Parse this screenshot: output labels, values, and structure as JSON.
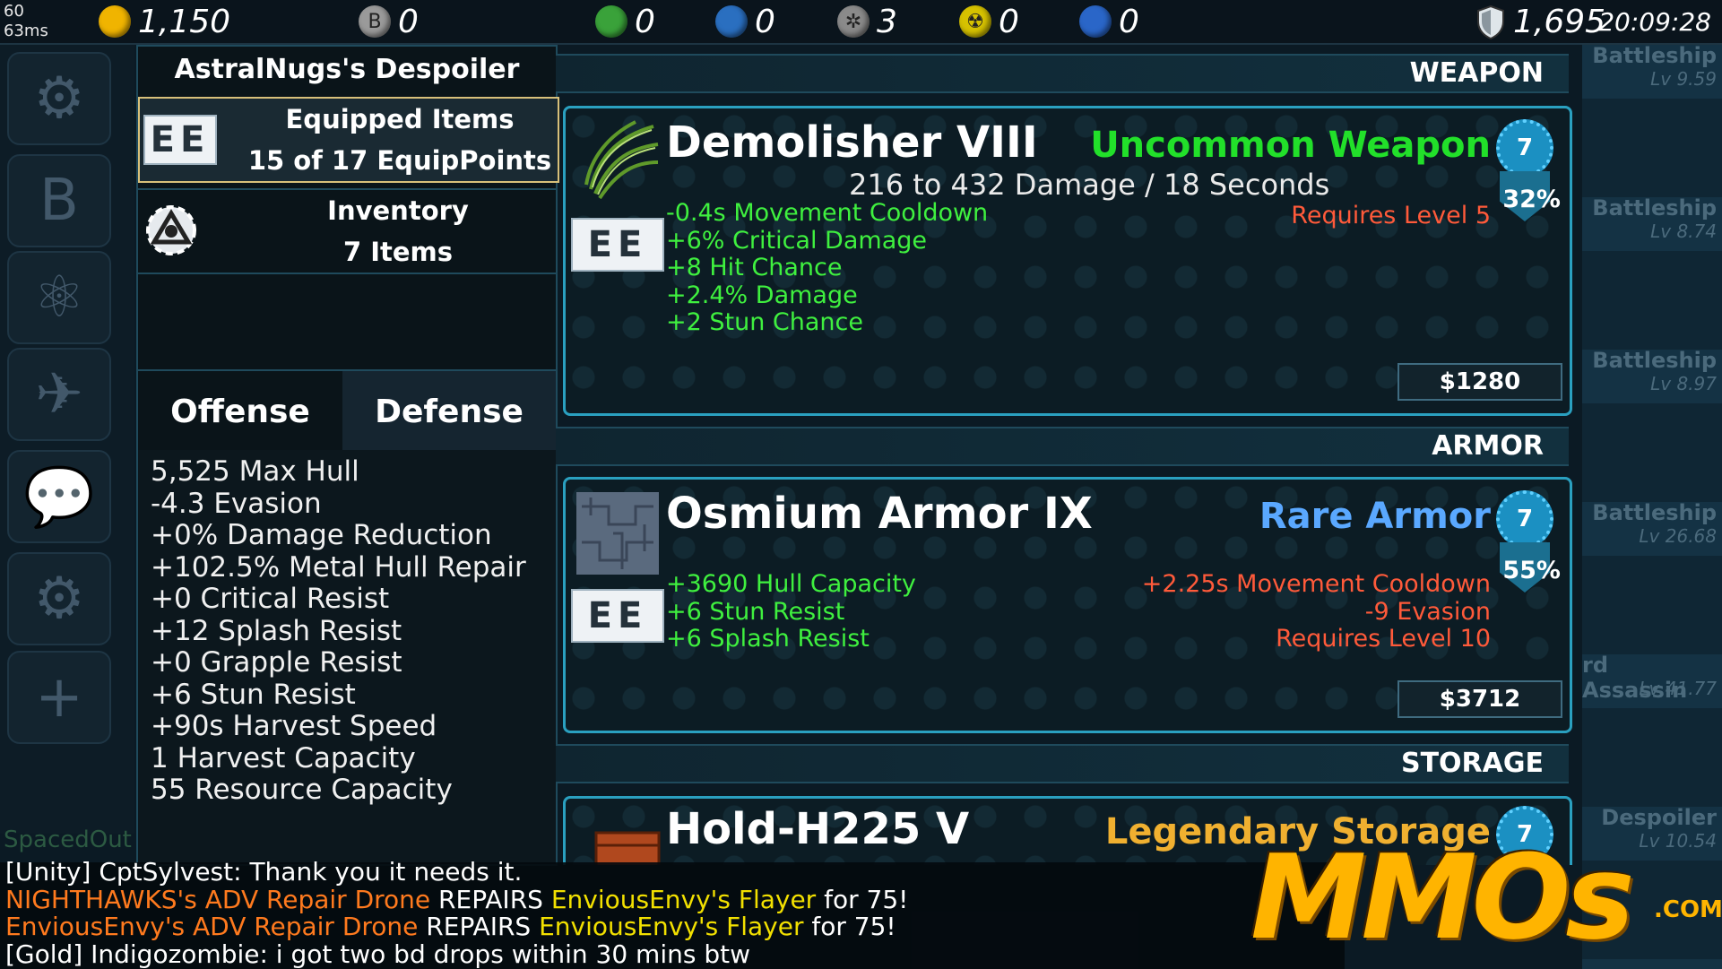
{
  "hud": {
    "fps": "60",
    "ping": "63ms",
    "resources": [
      {
        "icon": "gold-coin-icon",
        "color": "#f0b400",
        "glyph": "",
        "value": "1,150"
      },
      {
        "icon": "bitcoin-icon",
        "color": "#9a9a9a",
        "glyph": "B",
        "value": "0"
      },
      {
        "icon": "leaf-icon",
        "color": "#3aa23a",
        "glyph": "",
        "value": "0"
      },
      {
        "icon": "water-drop-icon",
        "color": "#2a6fc0",
        "glyph": "",
        "value": "0"
      },
      {
        "icon": "snowflake-icon",
        "color": "#8a8a8a",
        "glyph": "✲",
        "value": "3"
      },
      {
        "icon": "radiation-icon",
        "color": "#d6c200",
        "glyph": "☢",
        "value": "0"
      },
      {
        "icon": "gem-icon",
        "color": "#2a66c8",
        "glyph": "",
        "value": "0"
      }
    ],
    "shield_value": "1,695",
    "clock": "20:09:28"
  },
  "nav": [
    {
      "name": "nav-ship-gear-icon",
      "glyph": "⚙"
    },
    {
      "name": "nav-bitcoin-icon",
      "glyph": "B"
    },
    {
      "name": "nav-atom-icon",
      "glyph": "⚛"
    },
    {
      "name": "nav-ship-icon",
      "glyph": "✈"
    },
    {
      "name": "nav-chat-icon",
      "glyph": "💬"
    },
    {
      "name": "nav-settings-icon",
      "glyph": "⚙"
    },
    {
      "name": "nav-add-icon",
      "glyph": "+"
    }
  ],
  "right_list": [
    {
      "label": "Battleship",
      "level": "Lv 9.59"
    },
    {
      "label": "Battleship",
      "level": "Lv 8.74"
    },
    {
      "label": "Battleship",
      "level": "Lv 8.97"
    },
    {
      "label": "Battleship",
      "level": "Lv 26.68"
    },
    {
      "label": "rd Assassin",
      "level": "Lv 41.77"
    },
    {
      "label": "Despoiler",
      "level": "Lv 10.54"
    }
  ],
  "left_panel": {
    "ship_name": "AstralNugs's Despoiler",
    "equipped_title": "Equipped Items",
    "equipped_sub": "15 of 17 EquipPoints",
    "inventory_title": "Inventory",
    "inventory_sub": "7 Items",
    "tab_offense": "Offense",
    "tab_defense": "Defense",
    "stats": [
      "5,525 Max Hull",
      "-4.3 Evasion",
      "+0% Damage Reduction",
      "+102.5% Metal Hull Repair",
      "+0 Critical Resist",
      "+12 Splash Resist",
      "+0 Grapple Resist",
      "+6 Stun Resist",
      "+90s Harvest Speed",
      "1 Harvest Capacity",
      "55 Resource Capacity"
    ]
  },
  "slots": {
    "weapon": {
      "header": "WEAPON",
      "name": "Demolisher VIII",
      "rarity": "Uncommon Weapon",
      "rarity_color": "#22e02a",
      "damage": "216 to 432 Damage / 18 Seconds",
      "requires": "Requires Level 5",
      "level_badge": "7",
      "percent": "32%",
      "bonuses": [
        "-0.4s Movement Cooldown",
        "+6% Critical Damage",
        "+8 Hit Chance",
        "+2.4% Damage",
        "+2 Stun Chance"
      ],
      "penalties": [],
      "price": "$1280",
      "equip_glyph": "EE"
    },
    "armor": {
      "header": "ARMOR",
      "name": "Osmium Armor IX",
      "rarity": "Rare Armor",
      "rarity_color": "#5aa8ff",
      "level_badge": "7",
      "percent": "55%",
      "bonuses": [
        "+3690 Hull Capacity",
        "+6 Stun Resist",
        "+6 Splash Resist"
      ],
      "penalties": [
        "+2.25s Movement Cooldown",
        "-9 Evasion",
        "Requires Level 10"
      ],
      "price": "$3712",
      "equip_glyph": "EE"
    },
    "storage": {
      "header": "STORAGE",
      "name": "Hold-H225 V",
      "rarity": "Legendary Storage",
      "rarity_color": "#f0b030",
      "level_badge": "7"
    }
  },
  "chat": {
    "spaced_label": "SpacedOut",
    "lines": [
      [
        {
          "t": "[Unity] CptSylvest: Thank you it needs it.",
          "c": "white"
        }
      ],
      [
        {
          "t": "NIGHTHAWKS's ADV Repair Drone",
          "c": "orange"
        },
        {
          "t": " REPAIRS ",
          "c": "white"
        },
        {
          "t": "EnviousEnvy's Flayer",
          "c": "yellow"
        },
        {
          "t": " for 75!",
          "c": "white"
        }
      ],
      [
        {
          "t": "EnviousEnvy's ADV Repair Drone",
          "c": "orange"
        },
        {
          "t": " REPAIRS ",
          "c": "white"
        },
        {
          "t": "EnviousEnvy's Flayer",
          "c": "yellow"
        },
        {
          "t": " for 75!",
          "c": "white"
        }
      ],
      [
        {
          "t": "[Gold] Indigozombie: i got two bd drops within 30 mins btw",
          "c": "white"
        }
      ]
    ]
  },
  "watermark": {
    "text": "MMOs",
    "suffix": ".COM"
  }
}
